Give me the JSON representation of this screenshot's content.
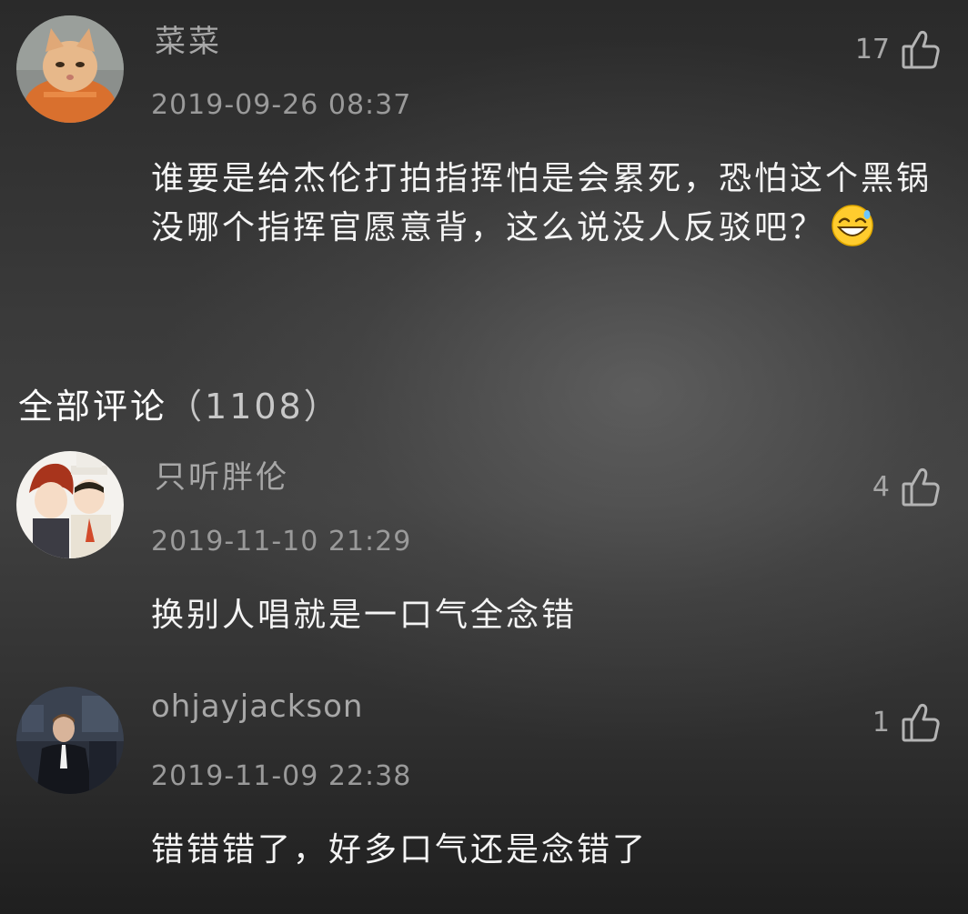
{
  "featured": {
    "username": "菜菜",
    "timestamp": "2019-09-26 08:37",
    "likes": "17",
    "text": "谁要是给杰伦打拍指挥怕是会累死，恐怕这个黑锅没哪个指挥官愿意背，这么说没人反驳吧？",
    "emoji_icon": "grinning-sweat-emoji-icon",
    "avatar_icon": "cat-avatar-icon"
  },
  "section": {
    "title": "全部评论",
    "count": "（1108）"
  },
  "comments": [
    {
      "username": "只听胖伦",
      "timestamp": "2019-11-10 21:29",
      "likes": "4",
      "text": "换别人唱就是一口气全念错",
      "avatar_icon": "anime-characters-avatar-icon"
    },
    {
      "username": "ohjayjackson",
      "timestamp": "2019-11-09 22:38",
      "likes": "1",
      "text": "错错错了，好多口气还是念错了",
      "avatar_icon": "person-photo-avatar-icon"
    }
  ],
  "colors": {
    "background": "#3a3a3a",
    "username": "#a7a7a7",
    "timestamp": "#9a9a9a",
    "body_text": "#f4f4f4"
  }
}
